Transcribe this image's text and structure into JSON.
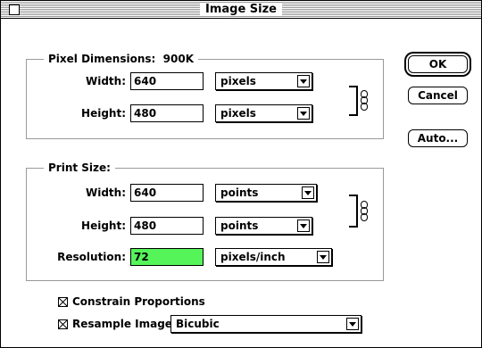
{
  "window": {
    "title": "Image Size"
  },
  "pixel_dimensions": {
    "legend": "Pixel Dimensions:  900K",
    "width_label": "Width:",
    "width_value": "640",
    "width_unit": "pixels",
    "height_label": "Height:",
    "height_value": "480",
    "height_unit": "pixels"
  },
  "print_size": {
    "legend": "Print Size:",
    "width_label": "Width:",
    "width_value": "640",
    "width_unit": "points",
    "height_label": "Height:",
    "height_value": "480",
    "height_unit": "points",
    "resolution_label": "Resolution:",
    "resolution_value": "72",
    "resolution_unit": "pixels/inch",
    "resolution_highlight": "#55f55a"
  },
  "options": {
    "constrain_label": "Constrain Proportions",
    "constrain_checked": true,
    "resample_label": "Resample Image:",
    "resample_checked": true,
    "resample_method": "Bicubic"
  },
  "buttons": {
    "ok": "OK",
    "cancel": "Cancel",
    "auto": "Auto..."
  }
}
